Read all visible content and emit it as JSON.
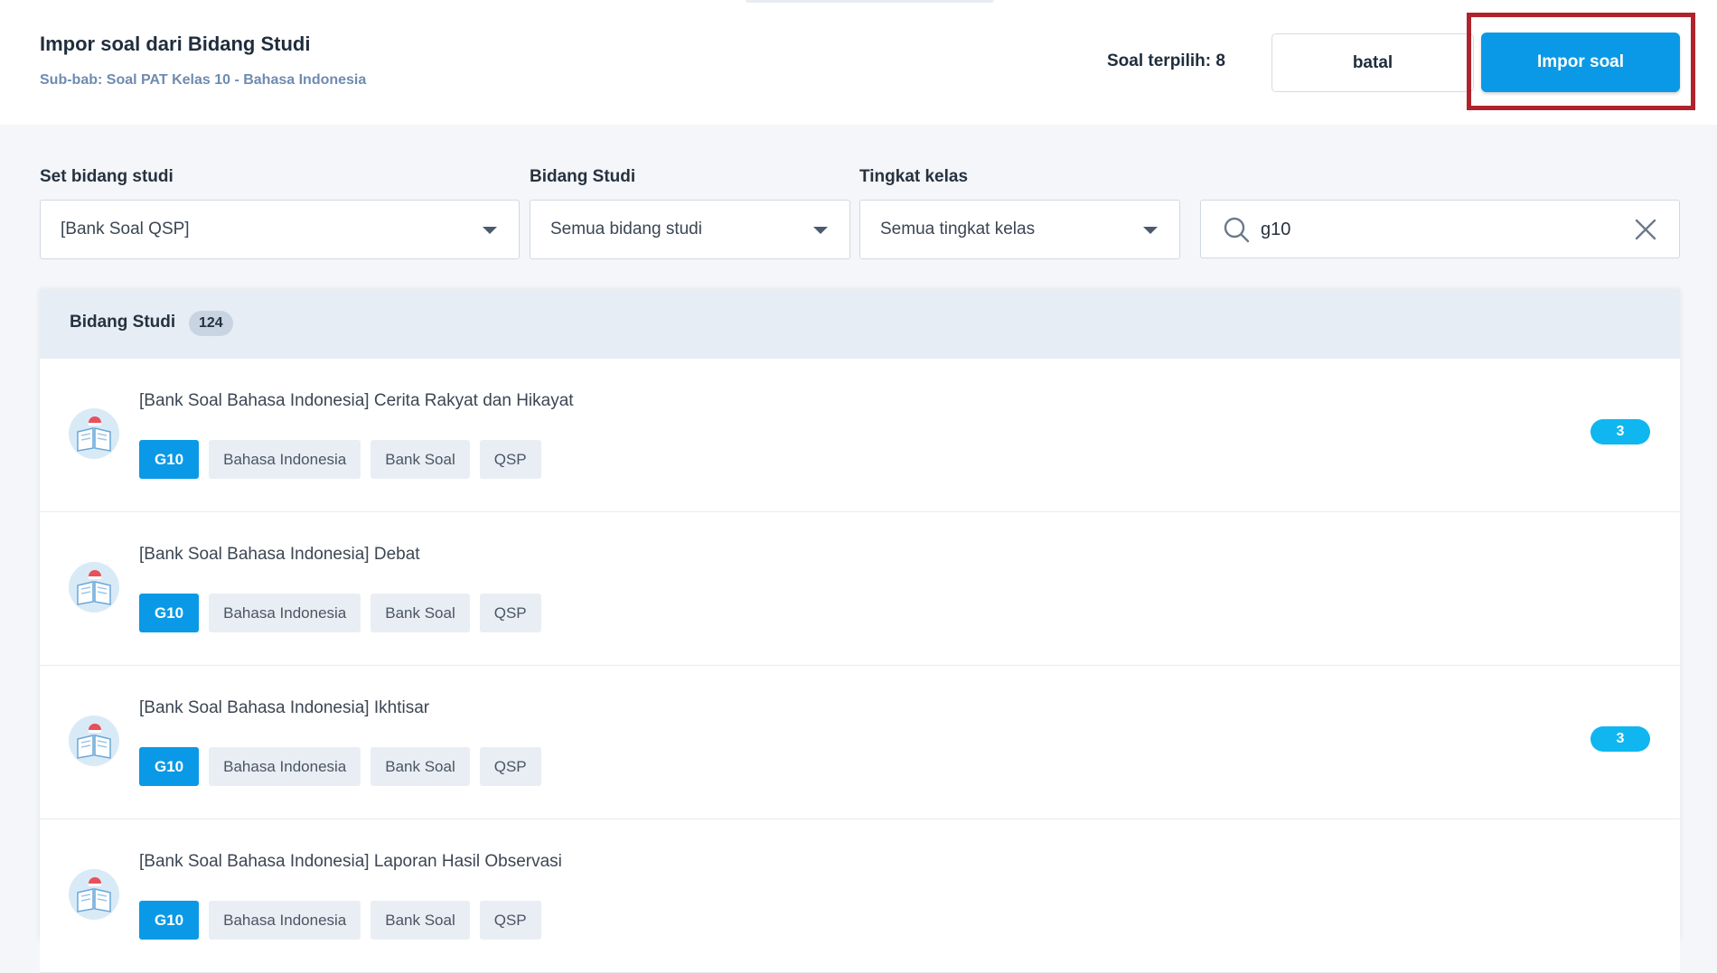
{
  "header": {
    "title": "Impor soal dari Bidang Studi",
    "subtitle": "Sub-bab: Soal PAT Kelas 10 - Bahasa Indonesia",
    "selected_count": "Soal terpilih: 8",
    "cancel_label": "batal",
    "import_label": "Impor soal",
    "highlight_color": "#b0232c"
  },
  "filters": {
    "set_label": "Set bidang studi",
    "set_value": "[Bank Soal QSP]",
    "subject_label": "Bidang Studi",
    "subject_value": "Semua bidang studi",
    "grade_label": "Tingkat kelas",
    "grade_value": "Semua tingkat kelas",
    "search_value": "g10"
  },
  "list": {
    "header_title": "Bidang Studi",
    "count": "124",
    "items": [
      {
        "title": "[Bank Soal Bahasa Indonesia] Cerita Rakyat dan Hikayat",
        "tags": [
          "G10",
          "Bahasa Indonesia",
          "Bank Soal",
          "QSP"
        ],
        "badge": "3"
      },
      {
        "title": "[Bank Soal Bahasa Indonesia] Debat",
        "tags": [
          "G10",
          "Bahasa Indonesia",
          "Bank Soal",
          "QSP"
        ],
        "badge": ""
      },
      {
        "title": "[Bank Soal Bahasa Indonesia] Ikhtisar",
        "tags": [
          "G10",
          "Bahasa Indonesia",
          "Bank Soal",
          "QSP"
        ],
        "badge": "3"
      },
      {
        "title": "[Bank Soal Bahasa Indonesia] Laporan Hasil Observasi",
        "tags": [
          "G10",
          "Bahasa Indonesia",
          "Bank Soal",
          "QSP"
        ],
        "badge": ""
      }
    ]
  },
  "icons": {
    "search": "search-icon",
    "clear": "close-icon",
    "dropdown": "chevron-down-icon",
    "subject_avatar": "book-icon"
  },
  "colors": {
    "accent": "#0a99e6",
    "badge": "#0fb6f0",
    "header_bg": "#e6edf5"
  }
}
